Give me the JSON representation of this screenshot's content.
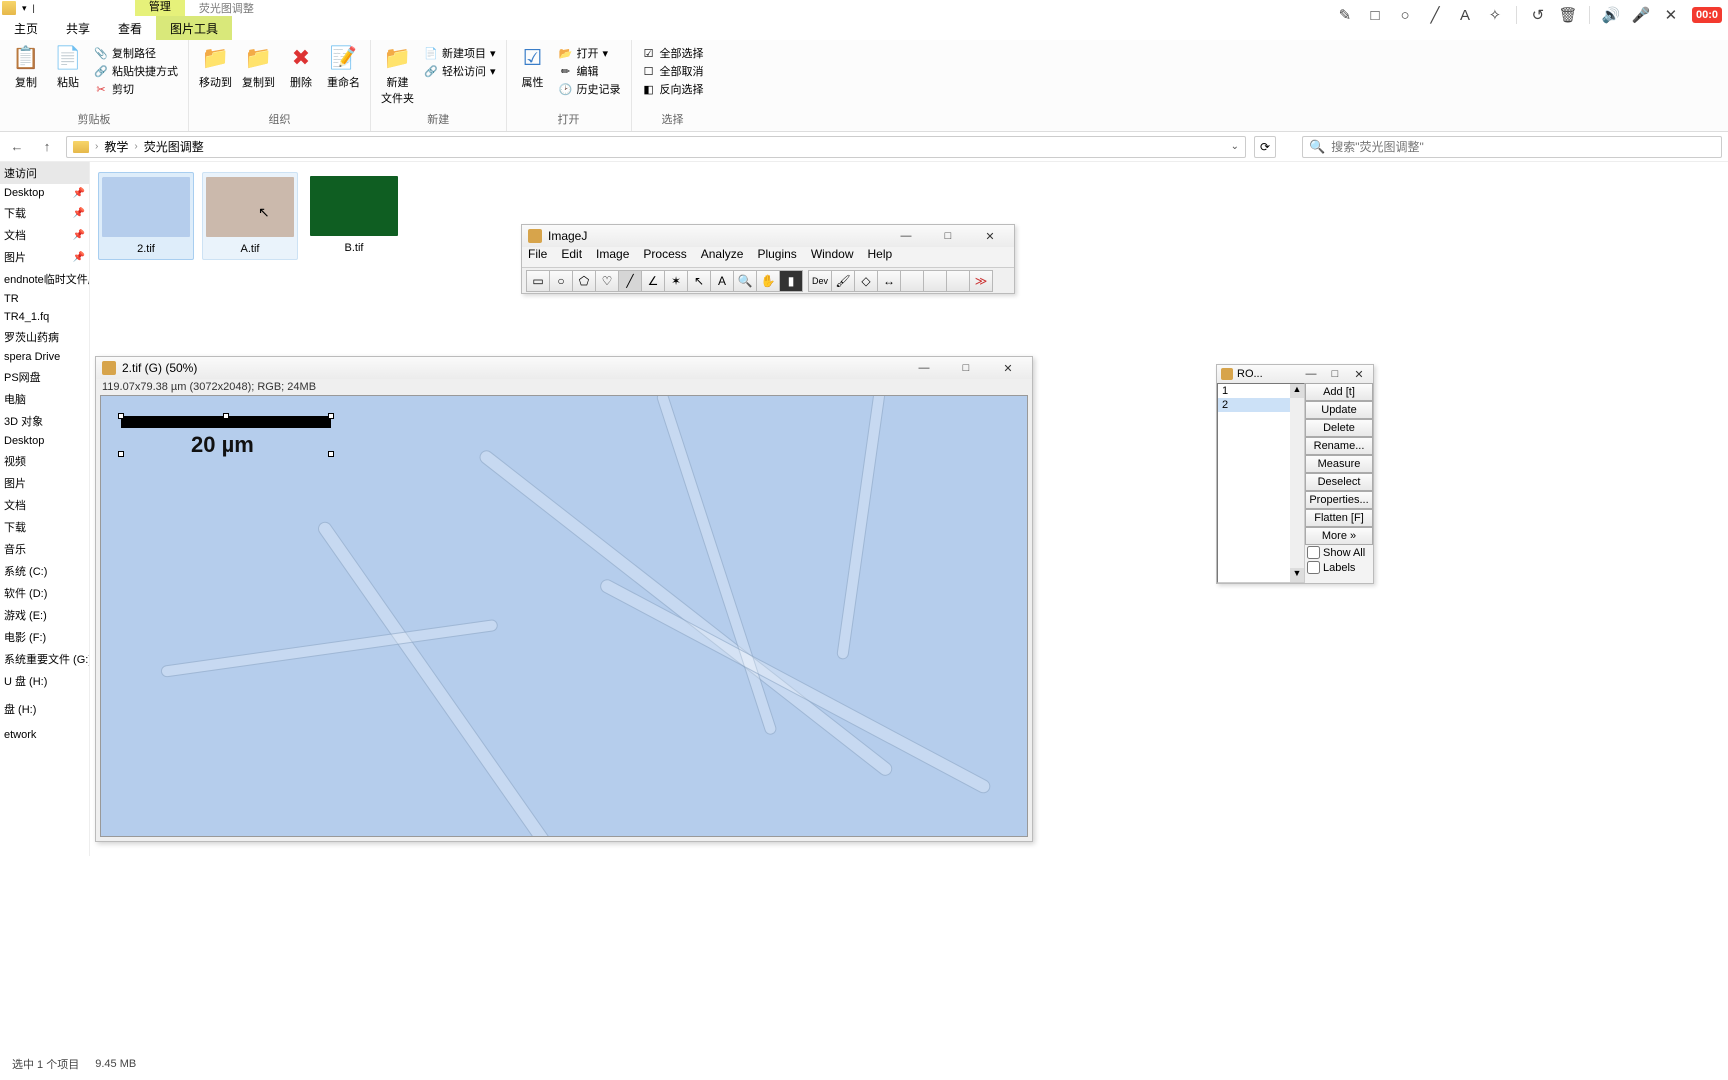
{
  "topmost": {
    "manage": "管理",
    "folder_title": "荧光图调整"
  },
  "topright": {
    "rec": "00:0"
  },
  "ribbon_tabs": {
    "home": "主页",
    "share": "共享",
    "view": "查看",
    "picture_tools": "图片工具"
  },
  "ribbon": {
    "clipboard": {
      "copy": "复制",
      "paste": "粘贴",
      "copy_path": "复制路径",
      "paste_shortcut": "粘贴快捷方式",
      "cut": "剪切",
      "group": "剪贴板"
    },
    "organize": {
      "move_to": "移动到",
      "copy_to": "复制到",
      "delete": "删除",
      "rename": "重命名",
      "group": "组织"
    },
    "new": {
      "new_folder": "新建\n文件夹",
      "new_item": "新建项目",
      "easy_access": "轻松访问",
      "group": "新建"
    },
    "open": {
      "properties": "属性",
      "open": "打开",
      "edit": "编辑",
      "history": "历史记录",
      "group": "打开"
    },
    "select": {
      "select_all": "全部选择",
      "select_none": "全部取消",
      "invert": "反向选择",
      "group": "选择"
    }
  },
  "breadcrumb": {
    "parent": "教学",
    "current": "荧光图调整"
  },
  "search": {
    "placeholder": "搜索\"荧光图调整\""
  },
  "sidebar": {
    "items": [
      {
        "label": "速访问",
        "header": true
      },
      {
        "label": "Desktop",
        "pin": true
      },
      {
        "label": "下载",
        "pin": true
      },
      {
        "label": "文档",
        "pin": true
      },
      {
        "label": "图片",
        "pin": true
      },
      {
        "label": "endnote临时文件库"
      },
      {
        "label": "TR"
      },
      {
        "label": "TR4_1.fq"
      },
      {
        "label": "罗茨山药病"
      },
      {
        "label": "spera Drive"
      },
      {
        "label": "PS网盘"
      },
      {
        "label": "电脑"
      },
      {
        "label": "3D 对象"
      },
      {
        "label": "Desktop"
      },
      {
        "label": "视频"
      },
      {
        "label": "图片"
      },
      {
        "label": "文档"
      },
      {
        "label": "下载"
      },
      {
        "label": "音乐"
      },
      {
        "label": "系统 (C:)"
      },
      {
        "label": "软件 (D:)"
      },
      {
        "label": "游戏 (E:)"
      },
      {
        "label": "电影 (F:)"
      },
      {
        "label": "系统重要文件 (G:)"
      },
      {
        "label": "U 盘 (H:)"
      },
      {
        "label": "盘 (H:)"
      },
      {
        "label": "etwork"
      }
    ]
  },
  "thumbs": [
    {
      "name": "2.tif",
      "bg": "#b5cdec"
    },
    {
      "name": "A.tif",
      "bg": "#cbb9ac"
    },
    {
      "name": "B.tif",
      "bg": "#0f5e22"
    }
  ],
  "imagej": {
    "title": "ImageJ",
    "menus": [
      "File",
      "Edit",
      "Image",
      "Process",
      "Analyze",
      "Plugins",
      "Window",
      "Help"
    ]
  },
  "tif": {
    "title": "2.tif (G) (50%)",
    "info": "119.07x79.38 µm (3072x2048); RGB; 24MB",
    "scale_label": "20 µm"
  },
  "roi": {
    "title": "RO...",
    "items": [
      "1",
      "2"
    ],
    "buttons": [
      "Add [t]",
      "Update",
      "Delete",
      "Rename...",
      "Measure",
      "Deselect",
      "Properties...",
      "Flatten [F]",
      "More »"
    ],
    "check_showall": "Show All",
    "check_labels": "Labels"
  },
  "status": {
    "selected": "选中 1 个项目",
    "size": "9.45 MB"
  }
}
